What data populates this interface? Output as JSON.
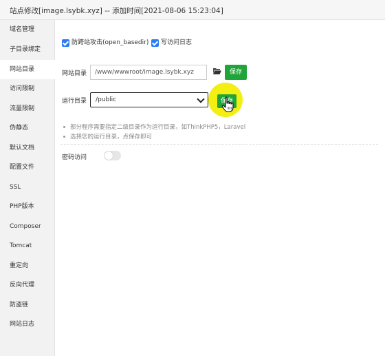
{
  "window": {
    "title": "站点修改[image.lsybk.xyz] -- 添加时间[2021-08-06 15:23:04]"
  },
  "sidebar": {
    "items": [
      {
        "label": "域名管理"
      },
      {
        "label": "子目录绑定"
      },
      {
        "label": "网站目录"
      },
      {
        "label": "访问限制"
      },
      {
        "label": "流量限制"
      },
      {
        "label": "伪静态"
      },
      {
        "label": "默认文档"
      },
      {
        "label": "配置文件"
      },
      {
        "label": "SSL"
      },
      {
        "label": "PHP版本"
      },
      {
        "label": "Composer"
      },
      {
        "label": "Tomcat"
      },
      {
        "label": "重定向"
      },
      {
        "label": "反向代理"
      },
      {
        "label": "防盗链"
      },
      {
        "label": "网站日志"
      }
    ],
    "active_index": 2
  },
  "options": {
    "anti_xss_label": "防跨站攻击(open_basedir)",
    "anti_xss_checked": true,
    "access_log_label": "写访问日志",
    "access_log_checked": true
  },
  "site_dir": {
    "label": "网站目录",
    "value": "/www/wwwroot/image.lsybk.xyz",
    "save_label": "保存",
    "folder_icon": "folder-open-icon"
  },
  "run_dir": {
    "label": "运行目录",
    "value": "/public",
    "save_label": "保存"
  },
  "tips": [
    "部分程序需要指定二级目录作为运行目录，如ThinkPHP5，Laravel",
    "选择您的运行目录，点保存即可"
  ],
  "password_access": {
    "label": "密码访问",
    "enabled": false
  },
  "colors": {
    "accent_green": "#20a53a",
    "checkbox_blue": "#2d7cf6",
    "cursor_highlight": "#f3ef12"
  }
}
